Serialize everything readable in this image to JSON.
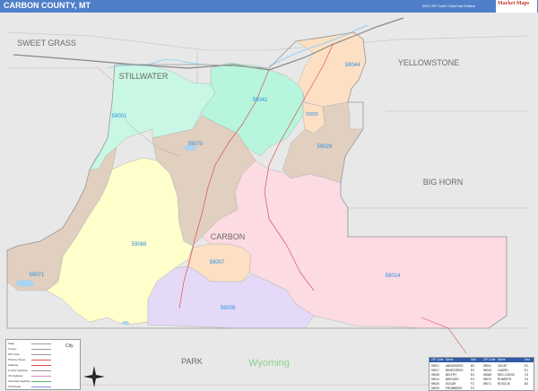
{
  "header": {
    "title": "CARBON COUNTY, MT",
    "edition": "2022 ZIP Code ColorCast Edition",
    "brand_logo": "Market Maps",
    "brand_sub": "MARKET MAPS"
  },
  "map": {
    "county_name": "CARBON",
    "state_name": "Wyoming",
    "neighbors": [
      "SWEET GRASS",
      "STILLWATER",
      "YELLOWSTONE",
      "BIG HORN",
      "PARK"
    ],
    "zips": [
      {
        "code": "59001",
        "color": "#c8f7e4"
      },
      {
        "code": "59041",
        "color": "#b7f5dd"
      },
      {
        "code": "59044",
        "color": "#fde0c4"
      },
      {
        "code": "59026",
        "color": "#fde0c4"
      },
      {
        "code": "59029",
        "color": "#e1cfbf"
      },
      {
        "code": "59070",
        "color": "#e1cfbf"
      },
      {
        "code": "59071",
        "color": "#e1cfbf"
      },
      {
        "code": "59068",
        "color": "#ffffcc"
      },
      {
        "code": "59007",
        "color": "#fde0c4"
      },
      {
        "code": "59014",
        "color": "#fcdbe3"
      },
      {
        "code": "59008",
        "color": "#e4daf7"
      }
    ],
    "label_color": "#2a8fe0",
    "neighbor_color": "#e8e8e8",
    "water_color": "#a6d4f2",
    "road_color": "#d9534f"
  },
  "legend": {
    "rows": [
      {
        "label": "State",
        "value": ""
      },
      {
        "label": "County",
        "value": ""
      },
      {
        "label": "ZIP Code",
        "value": ""
      },
      {
        "label": "Primary Street",
        "value": ""
      },
      {
        "label": "Highway",
        "value": ""
      },
      {
        "label": "County Highway",
        "value": ""
      },
      {
        "label": "US Highway",
        "value": ""
      },
      {
        "label": "Interstate Highway",
        "value": ""
      },
      {
        "label": "Toll Roads",
        "value": ""
      }
    ],
    "city_label": "City"
  },
  "zip_table": {
    "headers": [
      "ZIP Code",
      "Name",
      "Grid",
      "ZIP Code",
      "Name",
      "Grid"
    ],
    "rows": [
      [
        "59001",
        "ABSAROKEE",
        "B3",
        "59041",
        "JOLIET",
        "E2"
      ],
      [
        "59007",
        "BEARCREEK",
        "E3",
        "59044",
        "LAUREL",
        "E1"
      ],
      [
        "59008",
        "BELFRY",
        "E4",
        "59068",
        "RED LODGE",
        "C3"
      ],
      [
        "59014",
        "BRIDGER",
        "E3",
        "59070",
        "ROBERTS",
        "C4"
      ],
      [
        "59026",
        "EDGAR",
        "F2",
        "59071",
        "ROSCOE",
        "B3"
      ],
      [
        "59029",
        "FROMBERG",
        "F3",
        "",
        "",
        ""
      ]
    ]
  }
}
